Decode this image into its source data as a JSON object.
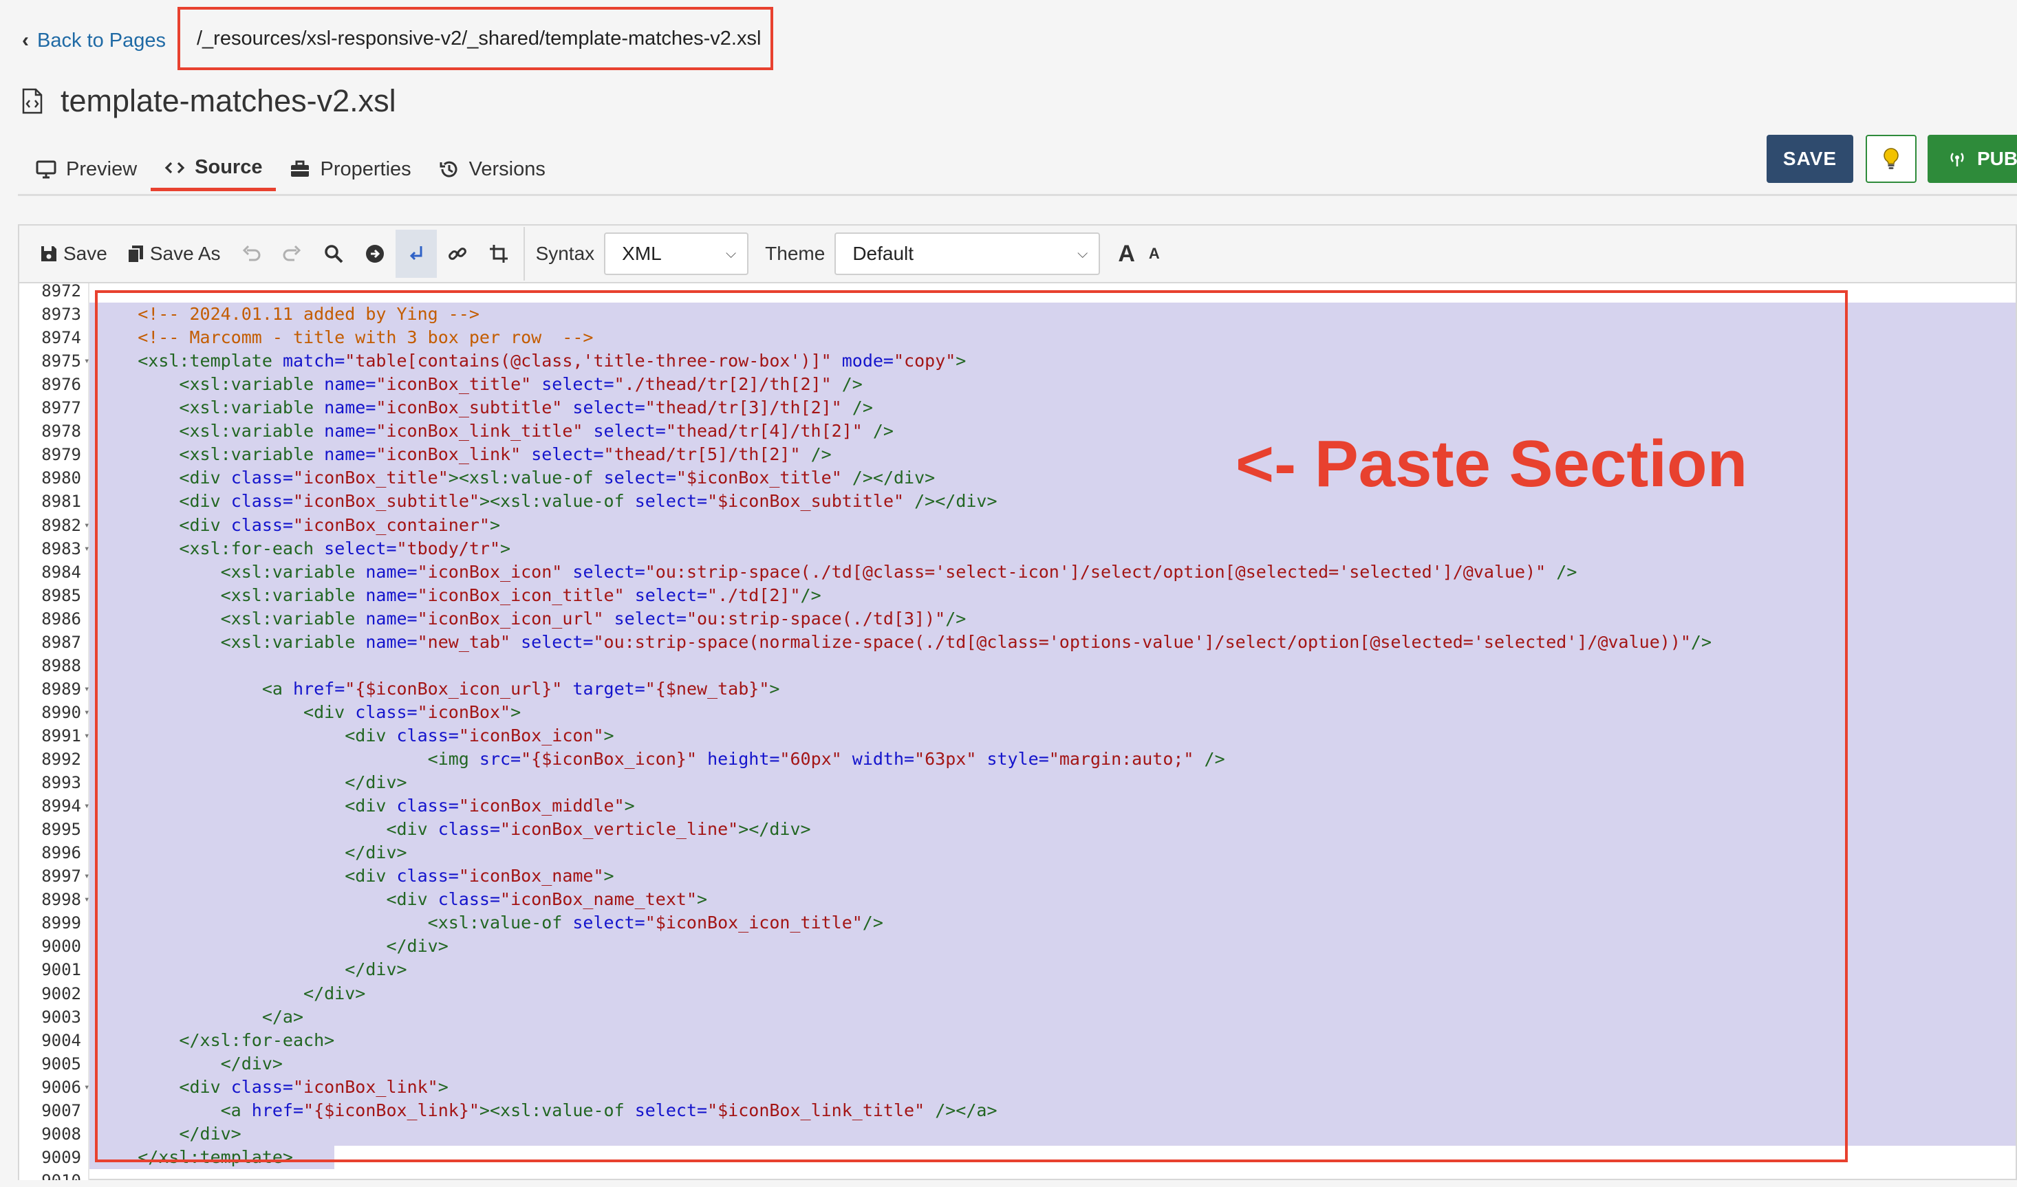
{
  "header": {
    "back_label": "Back to Pages",
    "path": "/_resources/xsl-responsive-v2/_shared/template-matches-v2.xsl",
    "title": "template-matches-v2.xsl"
  },
  "tabs": [
    {
      "label": "Preview",
      "icon": "monitor-icon",
      "active": false
    },
    {
      "label": "Source",
      "icon": "code-icon",
      "active": true
    },
    {
      "label": "Properties",
      "icon": "toolbox-icon",
      "active": false
    },
    {
      "label": "Versions",
      "icon": "history-icon",
      "active": false
    }
  ],
  "actions": {
    "save": "SAVE",
    "publish": "PUB",
    "colors": {
      "save": "#2f4b6e",
      "publish": "#2e8b3a",
      "accent": "#e8412f"
    }
  },
  "toolbar": {
    "save": "Save",
    "save_as": "Save As",
    "syntax_label": "Syntax",
    "syntax_value": "XML",
    "theme_label": "Theme",
    "theme_value": "Default",
    "font_up": "A",
    "font_down": "A"
  },
  "annotation": "<- Paste Section",
  "code": {
    "line_numbers": [
      "8972",
      "8973",
      "8974",
      "8975",
      "8976",
      "8977",
      "8978",
      "8979",
      "8980",
      "8981",
      "8982",
      "8983",
      "8984",
      "8985",
      "8986",
      "8987",
      "8988",
      "8989",
      "8990",
      "8991",
      "8992",
      "8993",
      "8994",
      "8995",
      "8996",
      "8997",
      "8998",
      "8999",
      "9000",
      "9001",
      "9002",
      "9003",
      "9004",
      "9005",
      "9006",
      "9007",
      "9008",
      "9009",
      "9010"
    ],
    "fold_lines": [
      "8975",
      "8982",
      "8983",
      "8989",
      "8990",
      "8991",
      "8994",
      "8997",
      "8998",
      "9006"
    ],
    "lines": [
      [],
      [
        [
          "c",
          "    <!-- 2024.01.11 added by Ying -->"
        ]
      ],
      [
        [
          "c",
          "    <!-- Marcomm - title with 3 box per row  -->"
        ]
      ],
      [
        [
          "p",
          "    "
        ],
        [
          "t",
          "<xsl:template "
        ],
        [
          "a",
          "match="
        ],
        [
          "s",
          "\"table[contains(@class,'title-three-row-box')]\" "
        ],
        [
          "a",
          "mode="
        ],
        [
          "s",
          "\"copy\""
        ],
        [
          "t",
          ">"
        ]
      ],
      [
        [
          "p",
          "        "
        ],
        [
          "t",
          "<xsl:variable "
        ],
        [
          "a",
          "name="
        ],
        [
          "s",
          "\"iconBox_title\" "
        ],
        [
          "a",
          "select="
        ],
        [
          "s",
          "\"./thead/tr[2]/th[2]\" "
        ],
        [
          "t",
          "/>"
        ]
      ],
      [
        [
          "p",
          "        "
        ],
        [
          "t",
          "<xsl:variable "
        ],
        [
          "a",
          "name="
        ],
        [
          "s",
          "\"iconBox_subtitle\" "
        ],
        [
          "a",
          "select="
        ],
        [
          "s",
          "\"thead/tr[3]/th[2]\" "
        ],
        [
          "t",
          "/>"
        ]
      ],
      [
        [
          "p",
          "        "
        ],
        [
          "t",
          "<xsl:variable "
        ],
        [
          "a",
          "name="
        ],
        [
          "s",
          "\"iconBox_link_title\" "
        ],
        [
          "a",
          "select="
        ],
        [
          "s",
          "\"thead/tr[4]/th[2]\" "
        ],
        [
          "t",
          "/>"
        ]
      ],
      [
        [
          "p",
          "        "
        ],
        [
          "t",
          "<xsl:variable "
        ],
        [
          "a",
          "name="
        ],
        [
          "s",
          "\"iconBox_link\" "
        ],
        [
          "a",
          "select="
        ],
        [
          "s",
          "\"thead/tr[5]/th[2]\" "
        ],
        [
          "t",
          "/>"
        ]
      ],
      [
        [
          "p",
          "        "
        ],
        [
          "t",
          "<div "
        ],
        [
          "a",
          "class="
        ],
        [
          "s",
          "\"iconBox_title\""
        ],
        [
          "t",
          "><xsl:value-of "
        ],
        [
          "a",
          "select="
        ],
        [
          "s",
          "\"$iconBox_title\" "
        ],
        [
          "t",
          "/></div>"
        ]
      ],
      [
        [
          "p",
          "        "
        ],
        [
          "t",
          "<div "
        ],
        [
          "a",
          "class="
        ],
        [
          "s",
          "\"iconBox_subtitle\""
        ],
        [
          "t",
          "><xsl:value-of "
        ],
        [
          "a",
          "select="
        ],
        [
          "s",
          "\"$iconBox_subtitle\" "
        ],
        [
          "t",
          "/></div>"
        ]
      ],
      [
        [
          "p",
          "        "
        ],
        [
          "t",
          "<div "
        ],
        [
          "a",
          "class="
        ],
        [
          "s",
          "\"iconBox_container\""
        ],
        [
          "t",
          ">"
        ]
      ],
      [
        [
          "p",
          "        "
        ],
        [
          "t",
          "<xsl:for-each "
        ],
        [
          "a",
          "select="
        ],
        [
          "s",
          "\"tbody/tr\""
        ],
        [
          "t",
          ">"
        ]
      ],
      [
        [
          "p",
          "            "
        ],
        [
          "t",
          "<xsl:variable "
        ],
        [
          "a",
          "name="
        ],
        [
          "s",
          "\"iconBox_icon\" "
        ],
        [
          "a",
          "select="
        ],
        [
          "s",
          "\"ou:strip-space(./td[@class='select-icon']/select/option[@selected='selected']/@value)\" "
        ],
        [
          "t",
          "/>"
        ]
      ],
      [
        [
          "p",
          "            "
        ],
        [
          "t",
          "<xsl:variable "
        ],
        [
          "a",
          "name="
        ],
        [
          "s",
          "\"iconBox_icon_title\" "
        ],
        [
          "a",
          "select="
        ],
        [
          "s",
          "\"./td[2]\""
        ],
        [
          "t",
          "/>"
        ]
      ],
      [
        [
          "p",
          "            "
        ],
        [
          "t",
          "<xsl:variable "
        ],
        [
          "a",
          "name="
        ],
        [
          "s",
          "\"iconBox_icon_url\" "
        ],
        [
          "a",
          "select="
        ],
        [
          "s",
          "\"ou:strip-space(./td[3])\""
        ],
        [
          "t",
          "/>"
        ]
      ],
      [
        [
          "p",
          "            "
        ],
        [
          "t",
          "<xsl:variable "
        ],
        [
          "a",
          "name="
        ],
        [
          "s",
          "\"new_tab\" "
        ],
        [
          "a",
          "select="
        ],
        [
          "s",
          "\"ou:strip-space(normalize-space(./td[@class='options-value']/select/option[@selected='selected']/@value))\""
        ],
        [
          "t",
          "/>"
        ]
      ],
      [],
      [
        [
          "p",
          "                "
        ],
        [
          "t",
          "<a "
        ],
        [
          "a",
          "href="
        ],
        [
          "s",
          "\"{$iconBox_icon_url}\" "
        ],
        [
          "a",
          "target="
        ],
        [
          "s",
          "\"{$new_tab}\""
        ],
        [
          "t",
          ">"
        ]
      ],
      [
        [
          "p",
          "                    "
        ],
        [
          "t",
          "<div "
        ],
        [
          "a",
          "class="
        ],
        [
          "s",
          "\"iconBox\""
        ],
        [
          "t",
          ">"
        ]
      ],
      [
        [
          "p",
          "                        "
        ],
        [
          "t",
          "<div "
        ],
        [
          "a",
          "class="
        ],
        [
          "s",
          "\"iconBox_icon\""
        ],
        [
          "t",
          ">"
        ]
      ],
      [
        [
          "p",
          "                                "
        ],
        [
          "t",
          "<img "
        ],
        [
          "a",
          "src="
        ],
        [
          "s",
          "\"{$iconBox_icon}\" "
        ],
        [
          "a",
          "height="
        ],
        [
          "s",
          "\"60px\" "
        ],
        [
          "a",
          "width="
        ],
        [
          "s",
          "\"63px\" "
        ],
        [
          "a",
          "style="
        ],
        [
          "s",
          "\"margin:auto;\" "
        ],
        [
          "t",
          "/>"
        ]
      ],
      [
        [
          "p",
          "                        "
        ],
        [
          "t",
          "</div>"
        ]
      ],
      [
        [
          "p",
          "                        "
        ],
        [
          "t",
          "<div "
        ],
        [
          "a",
          "class="
        ],
        [
          "s",
          "\"iconBox_middle\""
        ],
        [
          "t",
          ">"
        ]
      ],
      [
        [
          "p",
          "                            "
        ],
        [
          "t",
          "<div "
        ],
        [
          "a",
          "class="
        ],
        [
          "s",
          "\"iconBox_verticle_line\""
        ],
        [
          "t",
          "></div>"
        ]
      ],
      [
        [
          "p",
          "                        "
        ],
        [
          "t",
          "</div>"
        ]
      ],
      [
        [
          "p",
          "                        "
        ],
        [
          "t",
          "<div "
        ],
        [
          "a",
          "class="
        ],
        [
          "s",
          "\"iconBox_name\""
        ],
        [
          "t",
          ">"
        ]
      ],
      [
        [
          "p",
          "                            "
        ],
        [
          "t",
          "<div "
        ],
        [
          "a",
          "class="
        ],
        [
          "s",
          "\"iconBox_name_text\""
        ],
        [
          "t",
          ">"
        ]
      ],
      [
        [
          "p",
          "                                "
        ],
        [
          "t",
          "<xsl:value-of "
        ],
        [
          "a",
          "select="
        ],
        [
          "s",
          "\"$iconBox_icon_title\""
        ],
        [
          "t",
          "/>"
        ]
      ],
      [
        [
          "p",
          "                            "
        ],
        [
          "t",
          "</div>"
        ]
      ],
      [
        [
          "p",
          "                        "
        ],
        [
          "t",
          "</div>"
        ]
      ],
      [
        [
          "p",
          "                    "
        ],
        [
          "t",
          "</div>"
        ]
      ],
      [
        [
          "p",
          "                "
        ],
        [
          "t",
          "</a>"
        ]
      ],
      [
        [
          "p",
          "        "
        ],
        [
          "t",
          "</xsl:for-each>"
        ]
      ],
      [
        [
          "p",
          "            "
        ],
        [
          "t",
          "</div>"
        ]
      ],
      [
        [
          "p",
          "        "
        ],
        [
          "t",
          "<div "
        ],
        [
          "a",
          "class="
        ],
        [
          "s",
          "\"iconBox_link\""
        ],
        [
          "t",
          ">"
        ]
      ],
      [
        [
          "p",
          "            "
        ],
        [
          "t",
          "<a "
        ],
        [
          "a",
          "href="
        ],
        [
          "s",
          "\"{$iconBox_link}\""
        ],
        [
          "t",
          "><xsl:value-of "
        ],
        [
          "a",
          "select="
        ],
        [
          "s",
          "\"$iconBox_link_title\" "
        ],
        [
          "t",
          "/></a>"
        ]
      ],
      [
        [
          "p",
          "        "
        ],
        [
          "t",
          "</div>"
        ]
      ],
      [
        [
          "p",
          "    "
        ],
        [
          "t",
          "</xsl:template>"
        ]
      ],
      []
    ]
  }
}
